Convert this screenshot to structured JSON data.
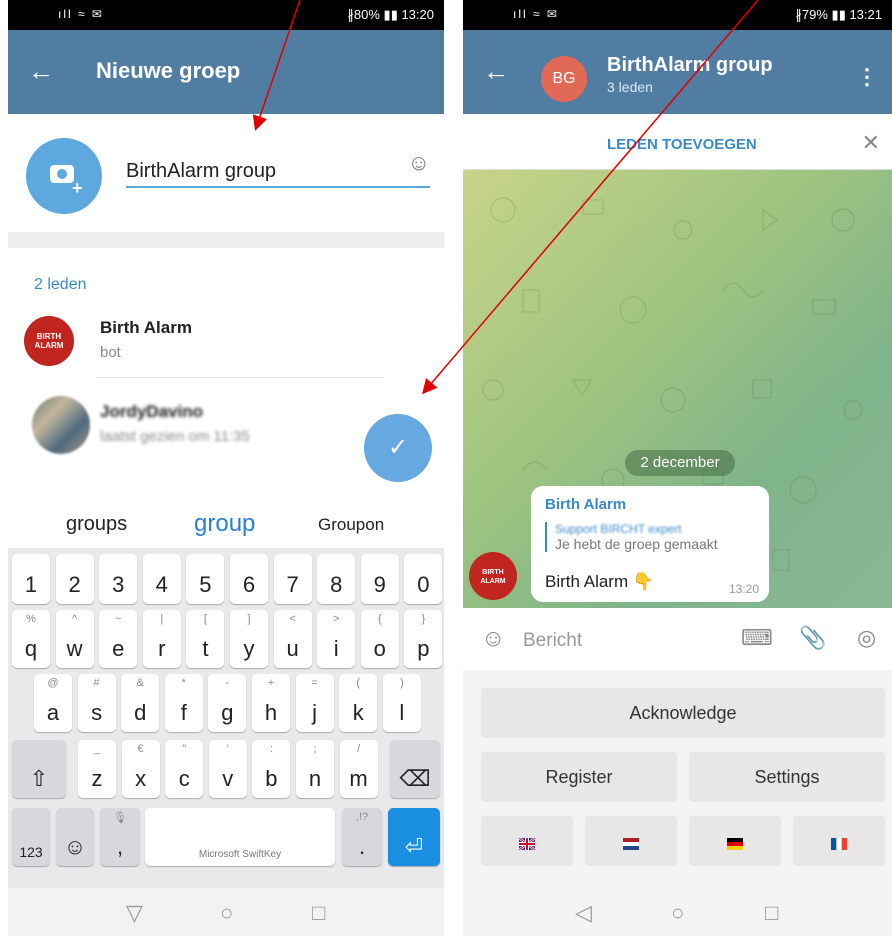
{
  "left": {
    "status": {
      "signal": "ıll ≈ ✉",
      "battery": "∦80% ▮▮ 13:20"
    },
    "appbar": {
      "back": "←",
      "title": "Nieuwe groep"
    },
    "group_name": "BirthAlarm group",
    "smiley": "☺",
    "members_label": "2 leden",
    "members": [
      {
        "name": "Birth Alarm",
        "status": "bot",
        "avatar_text": "BIRTH ALARM"
      },
      {
        "name": "JordyDavino",
        "status": "laatst gezien om 11:35"
      }
    ],
    "fab": "✓",
    "suggestions": [
      "groups",
      "group",
      "Groupon"
    ],
    "suggest_toggle": "⌃",
    "keyboard": {
      "numbers": [
        "1",
        "2",
        "3",
        "4",
        "5",
        "6",
        "7",
        "8",
        "9",
        "0"
      ],
      "row1": [
        [
          "%",
          "q"
        ],
        [
          "^",
          "w"
        ],
        [
          "~",
          "e"
        ],
        [
          "|",
          "r"
        ],
        [
          "[",
          "t"
        ],
        [
          "]",
          "y"
        ],
        [
          "<",
          "u"
        ],
        [
          ">",
          "i"
        ],
        [
          "{",
          "o"
        ],
        [
          "}",
          "p"
        ]
      ],
      "row2": [
        [
          "@",
          "a"
        ],
        [
          "#",
          "s"
        ],
        [
          "&",
          "d"
        ],
        [
          "*",
          "f"
        ],
        [
          "-",
          "g"
        ],
        [
          "+",
          "h"
        ],
        [
          "=",
          "j"
        ],
        [
          "(",
          "k"
        ],
        [
          ")",
          "l"
        ]
      ],
      "row3": [
        [
          "_",
          "z"
        ],
        [
          "€",
          "x"
        ],
        [
          "\"",
          "c"
        ],
        [
          "'",
          "v"
        ],
        [
          ":",
          "b"
        ],
        [
          ";",
          "n"
        ],
        [
          "/",
          "m"
        ]
      ],
      "shift": "⇧",
      "backspace": "⌫",
      "num_key": "123",
      "emoji_key": "☺",
      "comma_alt": "🎙",
      "comma": ",",
      "space_label": "Microsoft SwiftKey",
      "period_alt": ",!?",
      "period": ".",
      "enter": "⏎"
    },
    "nav": [
      "▽",
      "○",
      "□"
    ]
  },
  "right": {
    "status": {
      "signal": "ıll ≈ ✉",
      "battery": "∦79% ▮▮ 13:21"
    },
    "appbar": {
      "back": "←",
      "avatar": "BG",
      "title": "BirthAlarm group",
      "subtitle": "3 leden",
      "menu": "⋮"
    },
    "add_members": "LEDEN TOEVOEGEN",
    "close": "✕",
    "date": "2 december",
    "message": {
      "author": "Birth Alarm",
      "reply_title": "Support BIRCHT expert",
      "reply_text": "Je hebt de groep gemaakt",
      "text": "Birth Alarm 👇",
      "time": "13:20",
      "avatar_text": "BIRTH ALARM"
    },
    "composer": {
      "placeholder": "Bericht",
      "emoji": "☺",
      "keyboard_icon": "⌨",
      "attach_icon": "📎",
      "camera_icon": "◎"
    },
    "bot_keyboard": {
      "acknowledge": "Acknowledge",
      "register": "Register",
      "settings": "Settings",
      "flags": [
        "UK",
        "NL",
        "DE",
        "FR"
      ]
    },
    "nav": [
      "◁",
      "○",
      "□"
    ]
  },
  "colors": {
    "header": "#517da2",
    "accent": "#3a8ac8",
    "fab": "#65a9e0",
    "arrow": "#e00000"
  }
}
